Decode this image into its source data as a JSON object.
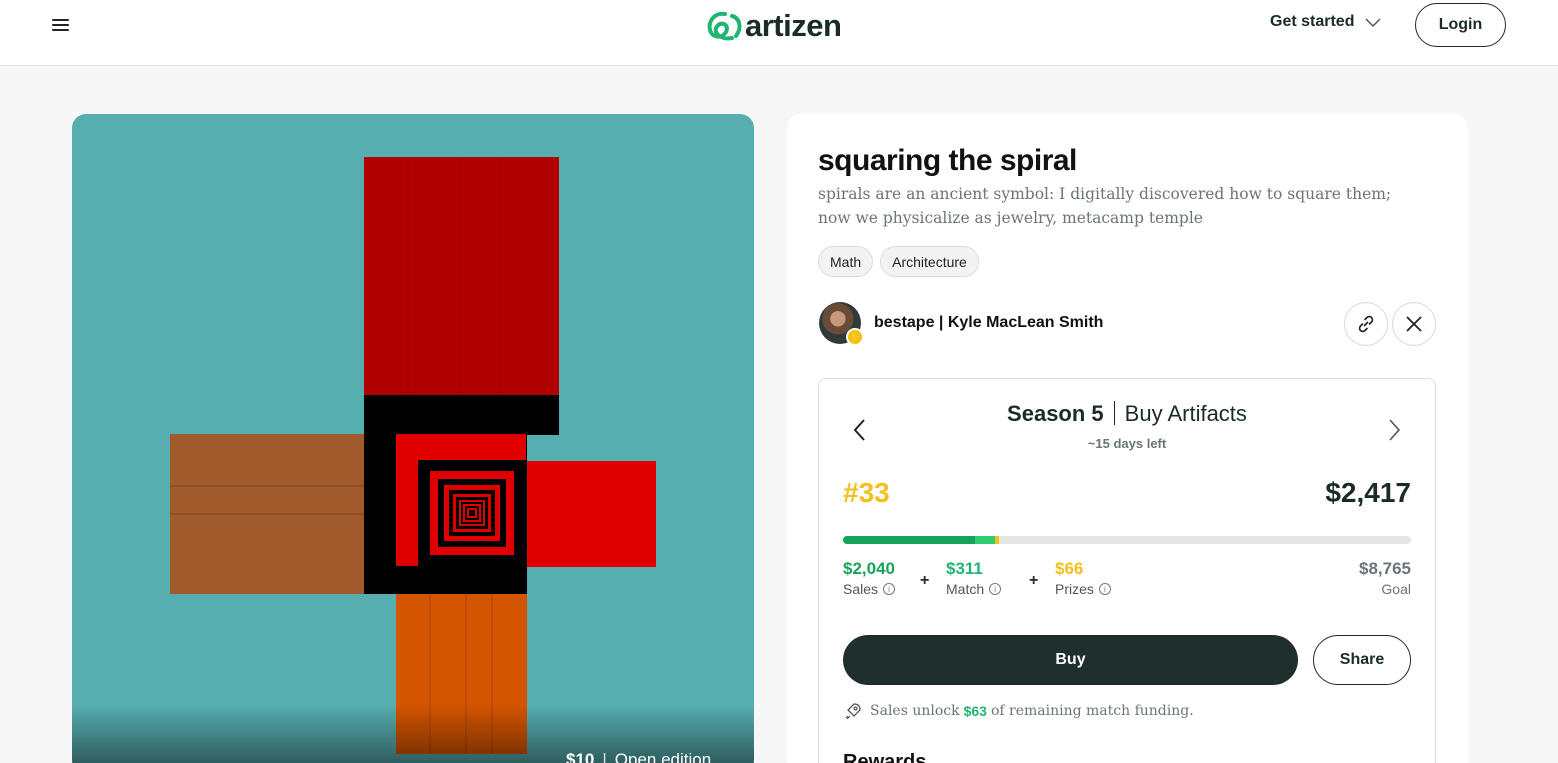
{
  "header": {
    "logo_text": "artizen",
    "get_started_label": "Get started",
    "login_label": "Login"
  },
  "artwork": {
    "price": "$10",
    "edition": "Open edition"
  },
  "project": {
    "title": "squaring the spiral",
    "description": "spirals are an ancient symbol: I digitally discovered how to square them; now we physicalize as jewelry, metacamp temple",
    "tags": [
      "Math",
      "Architecture"
    ],
    "artist_handle": "bestape",
    "artist_name": "Kyle MacLean Smith"
  },
  "season": {
    "name": "Season 5",
    "mode": "Buy Artifacts",
    "days_left": "~15 days left",
    "rank": "#33",
    "total": "$2,417",
    "progress": {
      "sales": 0.233,
      "match": 0.035,
      "prizes": 0.0075
    },
    "sales_value": "$2,040",
    "sales_label": "Sales",
    "match_value": "$311",
    "match_label": "Match",
    "prizes_value": "$66",
    "prizes_label": "Prizes",
    "goal_value": "$8,765",
    "goal_label": "Goal",
    "plus": "+",
    "buy_label": "Buy",
    "share_label": "Share",
    "unlock_prefix": "Sales unlock",
    "unlock_amount": "$63",
    "unlock_suffix": "of remaining match funding.",
    "rewards_heading": "Rewards"
  },
  "colors": {
    "accent_green": "#21b573",
    "dark_green": "#18a35a",
    "rank_yellow": "#f6bf1a",
    "button_dark": "#1f2f2e",
    "art_background": "#57aeb1"
  },
  "icons": [
    "menu-icon",
    "logo-mark-icon",
    "chevron-down-icon",
    "link-icon",
    "x-logo-icon",
    "chevron-left-icon",
    "chevron-right-icon",
    "info-icon",
    "rocket-icon",
    "lightning-icon"
  ]
}
